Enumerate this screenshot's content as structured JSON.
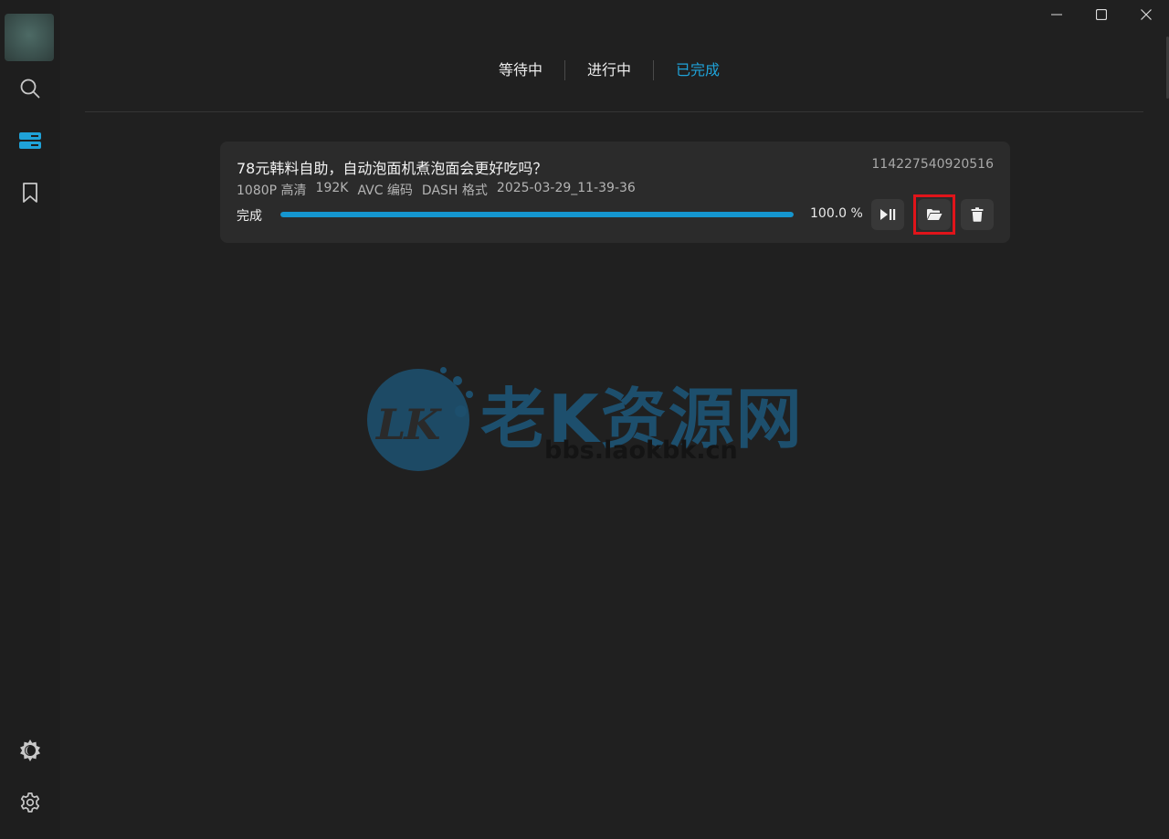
{
  "window": {
    "minimize_label": "minimize",
    "maximize_label": "maximize",
    "close_label": "close"
  },
  "sidebar": {
    "items": [
      {
        "name": "search",
        "icon": "search-icon"
      },
      {
        "name": "downloads",
        "icon": "server-icon",
        "active": true
      },
      {
        "name": "bookmarks",
        "icon": "bookmark-icon"
      },
      {
        "name": "theme",
        "icon": "theme-icon"
      },
      {
        "name": "settings",
        "icon": "gear-icon"
      }
    ]
  },
  "tabs": [
    {
      "label": "等待中",
      "active": false
    },
    {
      "label": "进行中",
      "active": false
    },
    {
      "label": "已完成",
      "active": true
    }
  ],
  "task": {
    "title": "78元韩料自助，自动泡面机煮泡面会更好吃吗？",
    "id": "114227540920516",
    "meta": {
      "quality": "1080P 高清",
      "audio": "192K",
      "codec": "AVC 编码",
      "format": "DASH 格式",
      "time": "2025-03-29_11-39-36"
    },
    "status": "完成",
    "progress_value": 1.0,
    "progress_text": "100.0 %",
    "actions": [
      {
        "name": "play-pause",
        "icon": "play-pause-icon"
      },
      {
        "name": "open-folder",
        "icon": "folder-open-icon",
        "highlighted": true
      },
      {
        "name": "delete",
        "icon": "trash-icon"
      }
    ]
  },
  "watermark": {
    "logo_text": "LK",
    "title": "老K资源网",
    "url": "bbs.laokbk.cn"
  },
  "colors": {
    "background": "#202020",
    "card": "#2b2b2b",
    "accent": "#1fa2d8",
    "progress": "#1596cf",
    "highlight": "#e0141a"
  }
}
